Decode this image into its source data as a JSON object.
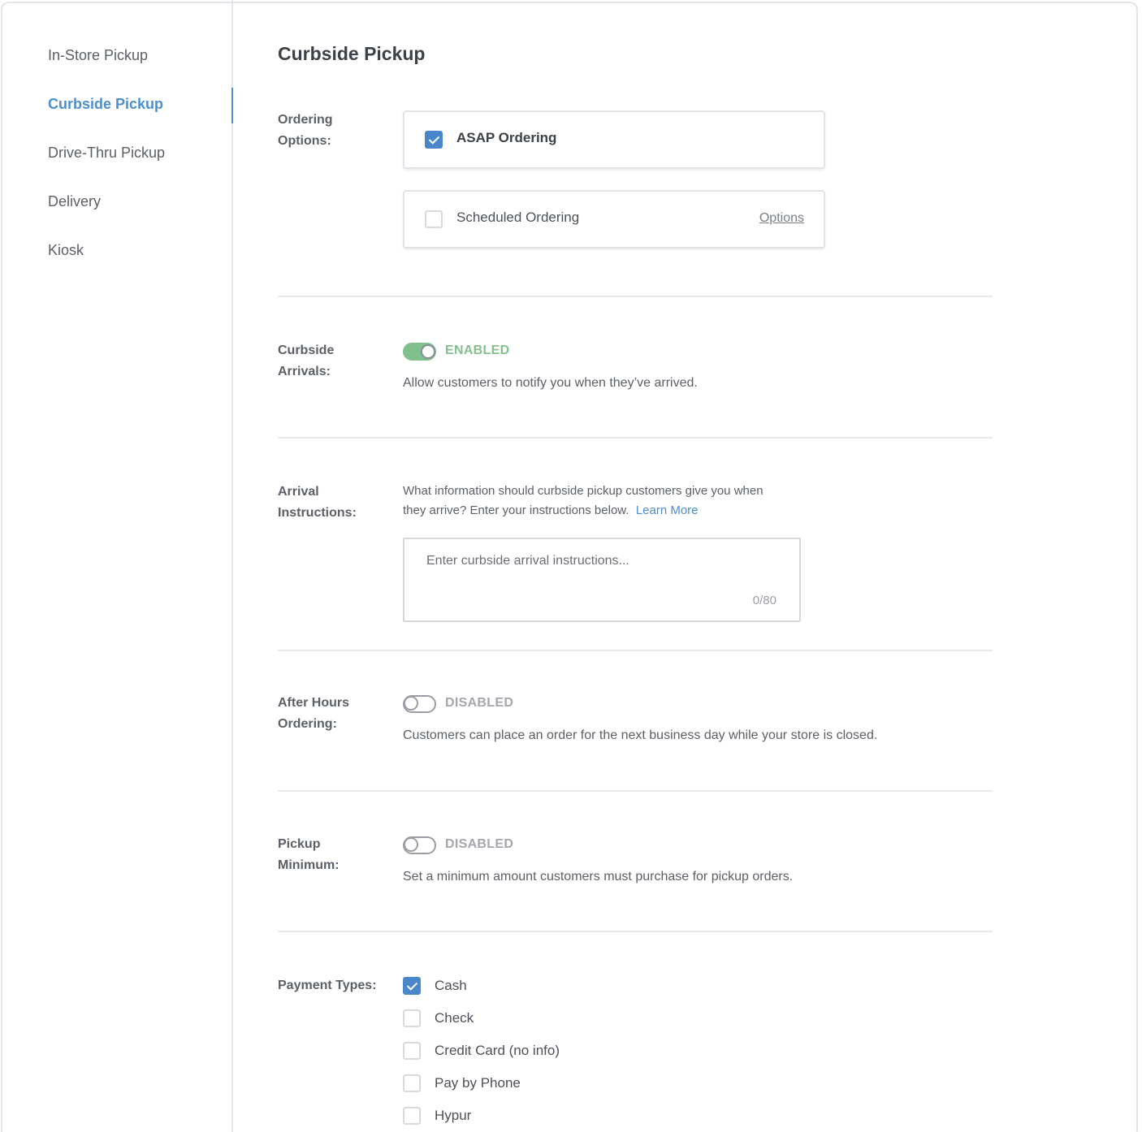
{
  "sidebar": {
    "items": [
      {
        "label": "In-Store Pickup"
      },
      {
        "label": "Curbside Pickup"
      },
      {
        "label": "Drive-Thru Pickup"
      },
      {
        "label": "Delivery"
      },
      {
        "label": "Kiosk"
      }
    ],
    "active_index": 1
  },
  "page": {
    "title": "Curbside Pickup"
  },
  "ordering_options": {
    "label": "Ordering Options:",
    "asap": {
      "label": "ASAP Ordering",
      "checked": true
    },
    "scheduled": {
      "label": "Scheduled Ordering",
      "checked": false,
      "link": "Options"
    }
  },
  "curbside_arrivals": {
    "label": "Curbside Arrivals:",
    "status": "ENABLED",
    "enabled": true,
    "description": "Allow customers to notify you when they’ve arrived."
  },
  "arrival_instructions": {
    "label": "Arrival Instructions:",
    "help_line1": "What information should curbside pickup customers give you when",
    "help_line2": "they arrive? Enter your instructions below.",
    "learn_more": "Learn More",
    "placeholder": "Enter curbside arrival instructions...",
    "value": "",
    "char_count": "0/80"
  },
  "after_hours": {
    "label": "After Hours Ordering:",
    "status": "DISABLED",
    "enabled": false,
    "description": "Customers can place an order for the next business day while your store is closed."
  },
  "pickup_minimum": {
    "label": "Pickup Minimum:",
    "status": "DISABLED",
    "enabled": false,
    "description": "Set a minimum amount customers must purchase for pickup orders."
  },
  "payment_types": {
    "label": "Payment Types:",
    "options": [
      {
        "label": "Cash",
        "checked": true
      },
      {
        "label": "Check",
        "checked": false
      },
      {
        "label": "Credit Card (no info)",
        "checked": false
      },
      {
        "label": "Pay by Phone",
        "checked": false
      },
      {
        "label": "Hypur",
        "checked": false
      }
    ]
  },
  "colors": {
    "accent": "#4a8fcf",
    "checkbox_checked": "#4a86cc",
    "toggle_on": "#7fc08d",
    "status_enabled": "#86c08f",
    "status_disabled": "#a3a7ad"
  }
}
